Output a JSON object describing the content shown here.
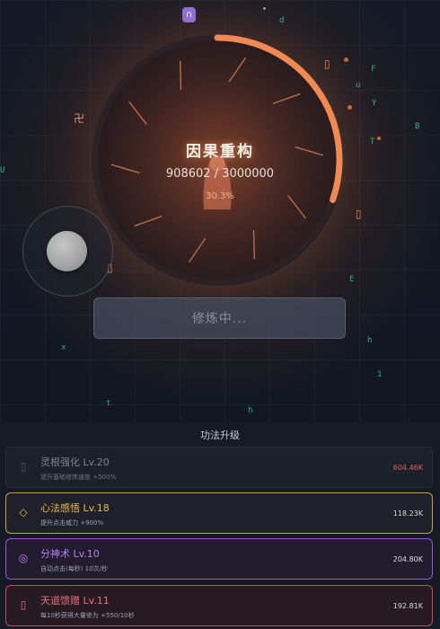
{
  "orb": {
    "title": "因果重构",
    "progress_text": "908602 / 3000000",
    "percent_text": "30.3%",
    "progress_fraction": 0.303
  },
  "cultivate_button": {
    "label": "修炼中..."
  },
  "panel": {
    "title": "功法升级",
    "skills": [
      {
        "icon": "locked-icon",
        "name": "灵根强化 Lv.20",
        "desc": "提升基础修炼速度 +500%",
        "cost": "604.46K",
        "accent": "#e26060"
      },
      {
        "icon": "diamond-icon",
        "name": "心法感悟 Lv.18",
        "desc": "提升点击威力 +900%",
        "cost": "118.23K",
        "accent": "#e8b84a"
      },
      {
        "icon": "spiral-icon",
        "name": "分神术 Lv.10",
        "desc": "自动点击(每秒) 10次/秒",
        "cost": "204.80K",
        "accent": "#c07cf0"
      },
      {
        "icon": "scroll-icon",
        "name": "天道馈赠 Lv.11",
        "desc": "每10秒获得大量修为 +550/10秒",
        "cost": "192.81K",
        "accent": "#ee6a7c"
      }
    ]
  },
  "scene_glyphs": [
    "d",
    "F",
    "u",
    "Y",
    "B",
    "T",
    "E",
    "x",
    "h",
    "1",
    "t",
    "h",
    "U",
    "卍"
  ]
}
